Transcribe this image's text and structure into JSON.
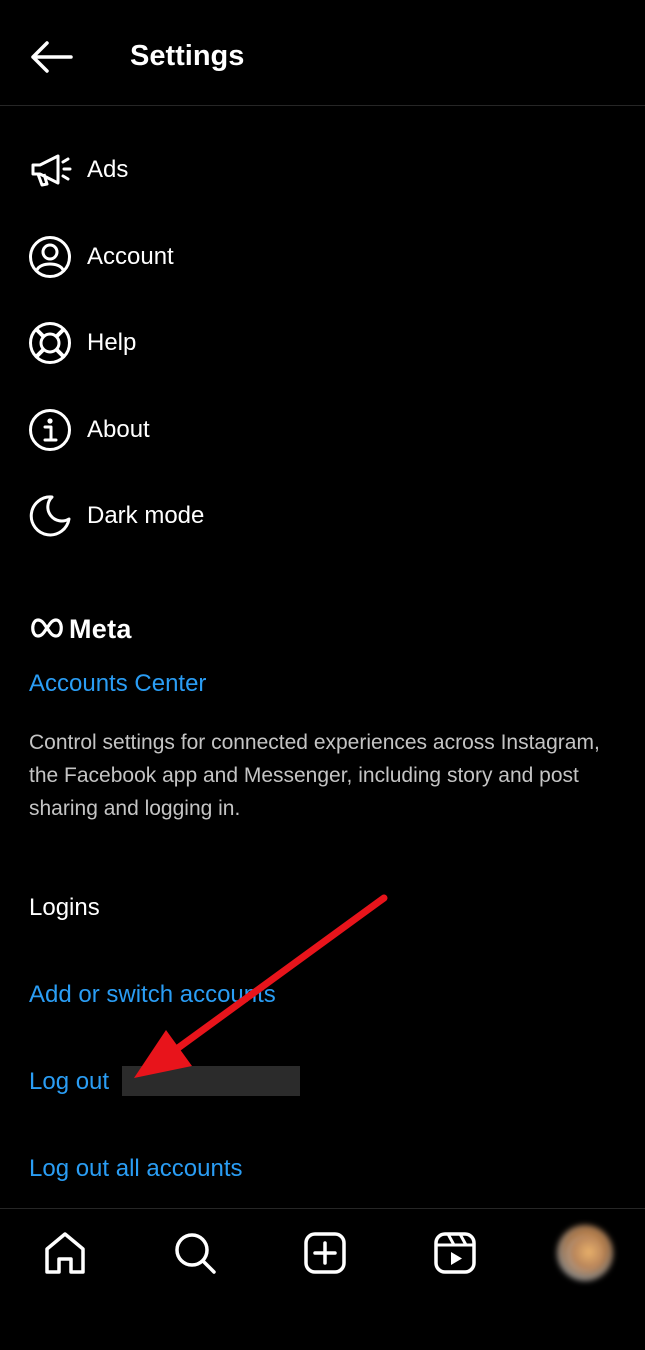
{
  "header": {
    "title": "Settings",
    "back_icon": "arrow-left-icon"
  },
  "menu": {
    "items": [
      {
        "label": "Ads",
        "icon": "megaphone-icon"
      },
      {
        "label": "Account",
        "icon": "person-circle-icon"
      },
      {
        "label": "Help",
        "icon": "lifebuoy-icon"
      },
      {
        "label": "About",
        "icon": "info-circle-icon"
      },
      {
        "label": "Dark mode",
        "icon": "moon-icon"
      }
    ]
  },
  "meta": {
    "logo_text": "Meta",
    "accounts_center": "Accounts Center",
    "description": "Control settings for connected experiences across Instagram, the Facebook app and Messenger, including story and post sharing and logging in."
  },
  "logins": {
    "heading": "Logins",
    "add_switch": "Add or switch accounts",
    "log_out": "Log out",
    "log_out_all": "Log out all accounts"
  },
  "bottom_nav": {
    "items": [
      "home-icon",
      "search-icon",
      "create-post-icon",
      "reels-icon",
      "profile-avatar"
    ]
  },
  "colors": {
    "background": "#000000",
    "link": "#2a9df4",
    "annotation_arrow": "#e8141b"
  }
}
